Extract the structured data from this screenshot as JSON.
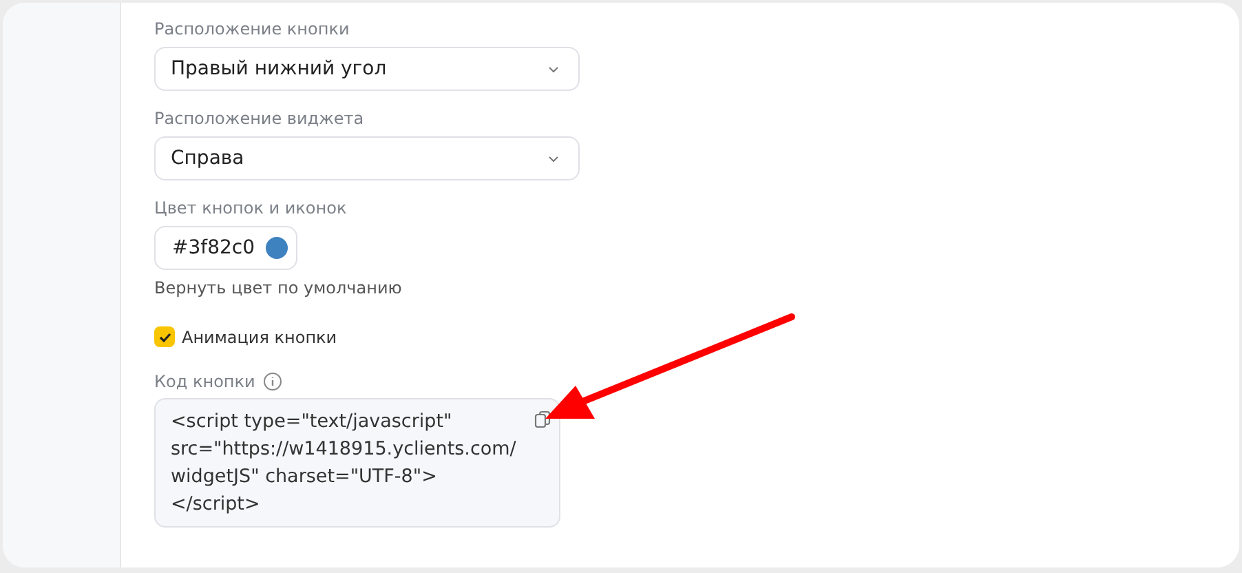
{
  "fields": [
    {
      "kind": "select",
      "label": "Расположение кнопки",
      "value": "Правый нижний угол"
    },
    {
      "kind": "select",
      "label": "Расположение виджета",
      "value": "Справа"
    },
    {
      "kind": "color",
      "label": "Цвет кнопок и иконок",
      "value": "#3f82c0",
      "color": "#3f82c0",
      "link": "Вернуть цвет по умолчанию"
    },
    {
      "kind": "checkbox",
      "label": "Анимация кнопки",
      "checked": true
    },
    {
      "kind": "code",
      "label": "Код кнопки",
      "value": "<script type=\"text/javascript\"\nsrc=\"https://w1418915.yclients.com/\nwidgetJS\" charset=\"UTF-8\">\n</script>"
    }
  ]
}
